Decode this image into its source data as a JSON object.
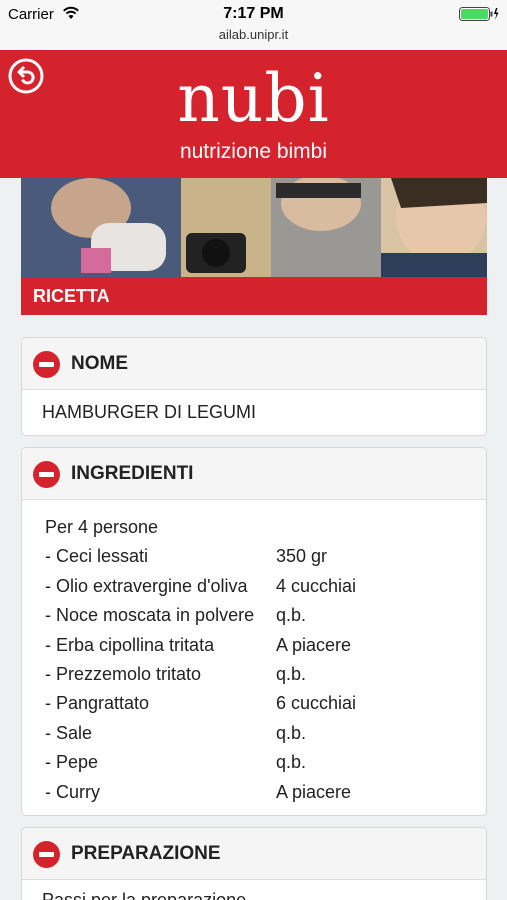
{
  "status": {
    "carrier": "Carrier",
    "time": "7:17 PM",
    "url": "ailab.unipr.it"
  },
  "header": {
    "logo": "nubi",
    "subtitle": "nutrizione bimbi",
    "brand_color": "#d4232d"
  },
  "section": {
    "label": "RICETTA"
  },
  "nome": {
    "title": "NOME",
    "value": "HAMBURGER DI LEGUMI"
  },
  "ingredienti": {
    "title": "INGREDIENTI",
    "persons": "Per 4 persone",
    "items": [
      {
        "name": "- Ceci lessati",
        "qty": "350 gr"
      },
      {
        "name": "- Olio extravergine d'oliva",
        "qty": "4 cucchiai"
      },
      {
        "name": "- Noce moscata in polvere",
        "qty": "q.b."
      },
      {
        "name": "- Erba cipollina tritata",
        "qty": "A piacere"
      },
      {
        "name": "- Prezzemolo tritato",
        "qty": "q.b."
      },
      {
        "name": "- Pangrattato",
        "qty": "6 cucchiai"
      },
      {
        "name": "- Sale",
        "qty": "q.b."
      },
      {
        "name": "- Pepe",
        "qty": "q.b."
      },
      {
        "name": "- Curry",
        "qty": "A piacere"
      }
    ]
  },
  "preparazione": {
    "title": "PREPARAZIONE",
    "first_line": "Passi per la preparazione"
  },
  "icons": {
    "back": "back-arrow-icon",
    "collapse": "minus-circle-icon",
    "wifi": "wifi-icon",
    "battery": "battery-icon"
  }
}
